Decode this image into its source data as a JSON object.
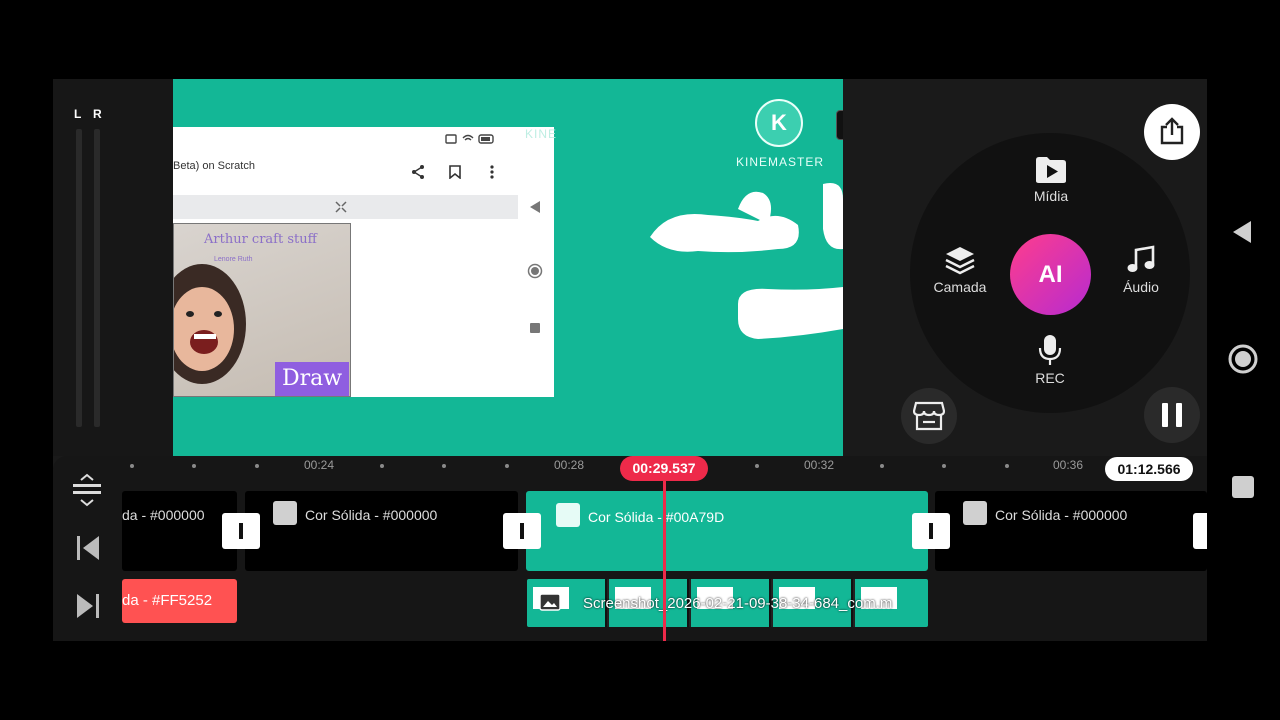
{
  "meter": {
    "left": "L",
    "right": "R"
  },
  "preview": {
    "shot_title": "Beta) on Scratch",
    "photo_title": "Arthur craft stuff",
    "photo_sub": "Lenore Ruth",
    "draw_label": "Draw",
    "watermark_faint": "KINE",
    "logo_letter": "K",
    "logo_text": "KINEMASTER"
  },
  "menu": {
    "media": "Mídia",
    "layer": "Camada",
    "audio": "Áudio",
    "rec": "REC",
    "ai": "AI"
  },
  "timeline": {
    "ruler": [
      "00:24",
      "00:28",
      "00:32",
      "00:36"
    ],
    "current_time": "00:29.537",
    "total_time": "01:12.566",
    "clips": [
      {
        "label": "da - #000000"
      },
      {
        "label": "Cor Sólida - #000000"
      },
      {
        "label": "Cor Sólida - #00A79D"
      },
      {
        "label": "Cor Sólida - #000000"
      }
    ],
    "layer_red": "da - #FF5252",
    "video_label": "Screenshot_2026-02-21-09-38-34-684_com.m"
  },
  "colors": {
    "accent_teal": "#13B796",
    "playhead_red": "#EE2A4A",
    "layer_red": "#FF5252"
  }
}
